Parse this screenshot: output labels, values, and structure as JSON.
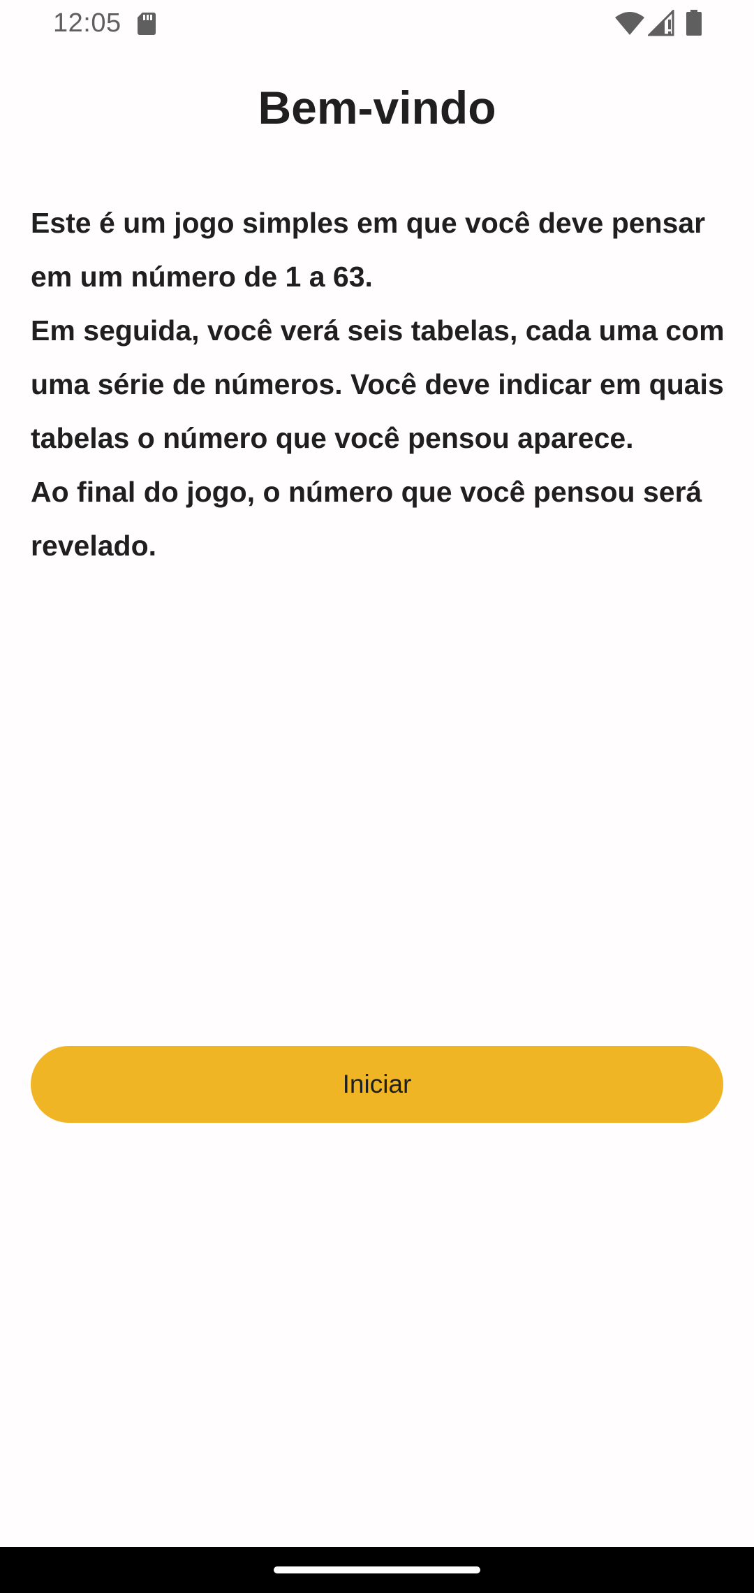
{
  "status_bar": {
    "time": "12:05",
    "icons": [
      "sd-card-icon",
      "wifi-icon",
      "signal-icon",
      "battery-icon"
    ]
  },
  "header": {
    "title": "Bem-vindo"
  },
  "intro": {
    "paragraphs": [
      "Este é um jogo simples em que você deve pensar em um número de 1 a 63.",
      "Em seguida, você verá seis tabelas, cada uma com uma série de números. Você deve indicar em quais tabelas o número que você pensou aparece.",
      "Ao final do jogo, o número que você pensou será revelado."
    ]
  },
  "actions": {
    "start_label": "Iniciar"
  },
  "colors": {
    "accent": "#efb524",
    "text": "#1f1f1f",
    "background": "#fffdfd"
  }
}
